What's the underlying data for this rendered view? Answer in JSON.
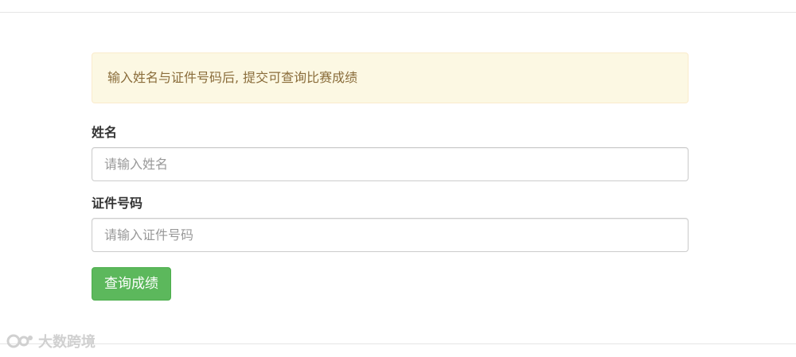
{
  "notice": {
    "text": "输入姓名与证件号码后, 提交可查询比赛成绩"
  },
  "form": {
    "name_label": "姓名",
    "name_placeholder": "请输入姓名",
    "id_label": "证件号码",
    "id_placeholder": "请输入证件号码",
    "submit_label": "查询成绩"
  },
  "watermark": {
    "text": "大数跨境",
    "icon": "brand-logo-icon"
  },
  "colors": {
    "alert_background": "#fcf8e3",
    "alert_text": "#8a6d3b",
    "submit_button": "#5cb85c"
  }
}
